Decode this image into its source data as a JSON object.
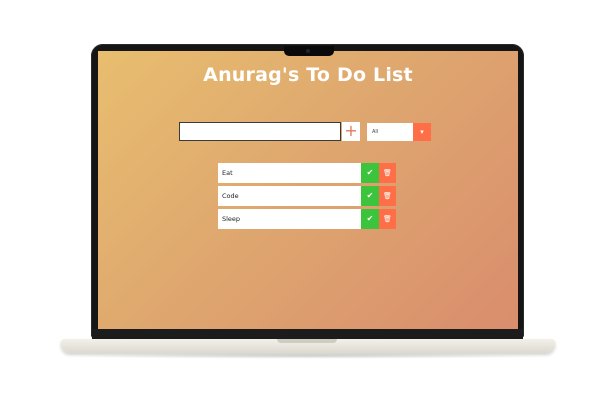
{
  "app": {
    "title": "Anurag's To Do List"
  },
  "input": {
    "value": "",
    "placeholder": ""
  },
  "add_button": {
    "icon": "plus-icon",
    "label": "+"
  },
  "filter": {
    "selected": "All",
    "arrow_icon": "chevron-down-icon",
    "arrow_label": "▾"
  },
  "todos": [
    {
      "text": "Eat",
      "check_label": "✔",
      "trash_label": "🗑"
    },
    {
      "text": "Code",
      "check_label": "✔",
      "trash_label": "🗑"
    },
    {
      "text": "Sleep",
      "check_label": "✔",
      "trash_label": "🗑"
    }
  ],
  "colors": {
    "gradient_start": "#e8be6f",
    "gradient_end": "#d98d6d",
    "check": "#3cc43c",
    "trash": "#ff6f47",
    "accent": "#e07b5a"
  }
}
